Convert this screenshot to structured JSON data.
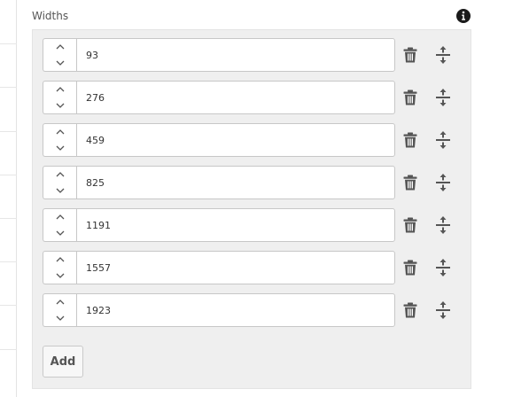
{
  "section": {
    "label": "Widths"
  },
  "widths": [
    "93",
    "276",
    "459",
    "825",
    "1191",
    "1557",
    "1923"
  ],
  "add_label": "Add",
  "icons": {
    "info": "info-circle-icon",
    "up": "chevron-up-icon",
    "down": "chevron-down-icon",
    "delete": "trash-icon",
    "move": "drag-vertical-icon"
  },
  "colors": {
    "icon": "#555555",
    "list_bg": "#efefef",
    "border": "#c7c7c7"
  }
}
